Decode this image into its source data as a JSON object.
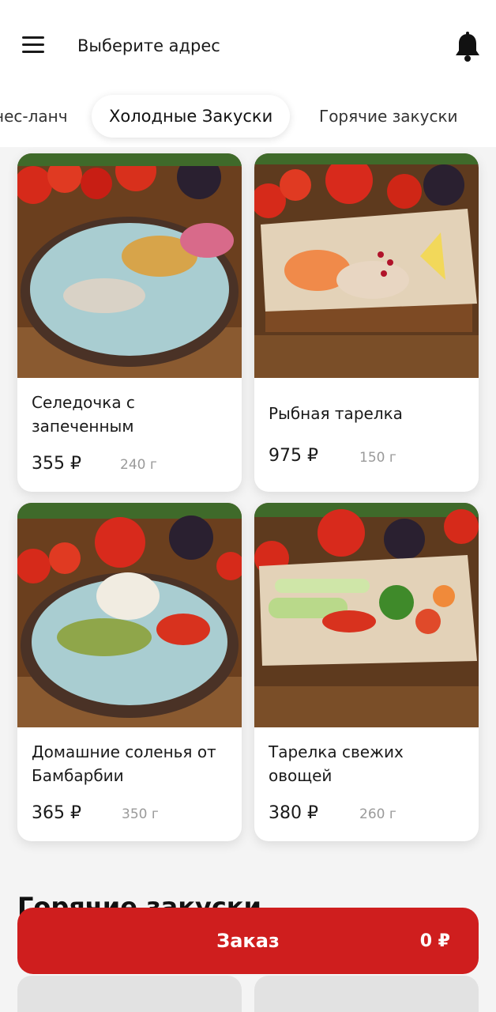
{
  "header": {
    "address_label": "Выберите адрес"
  },
  "tabs": [
    {
      "label": "нес-ланч",
      "active": false
    },
    {
      "label": "Холодные Закуски",
      "active": true
    },
    {
      "label": "Горячие закуски",
      "active": false
    }
  ],
  "products": [
    {
      "name": "Селедочка с запеченным",
      "price": "355 ₽",
      "weight": "240 г"
    },
    {
      "name": "Рыбная тарелка",
      "price": "975 ₽",
      "weight": "150 г"
    },
    {
      "name": "Домашние соленья от Бамбарбии",
      "price": "365 ₽",
      "weight": "350 г"
    },
    {
      "name": "Тарелка свежих овощей",
      "price": "380 ₽",
      "weight": "260 г"
    }
  ],
  "next_section_title": "Горячие закуски",
  "order": {
    "label": "Заказ",
    "total": "0 ₽"
  },
  "icons": {
    "menu": "hamburger-menu-icon",
    "notifications": "bell-icon"
  },
  "colors": {
    "accent": "#cf1e1e",
    "background": "#f4f4f4",
    "card": "#ffffff"
  }
}
